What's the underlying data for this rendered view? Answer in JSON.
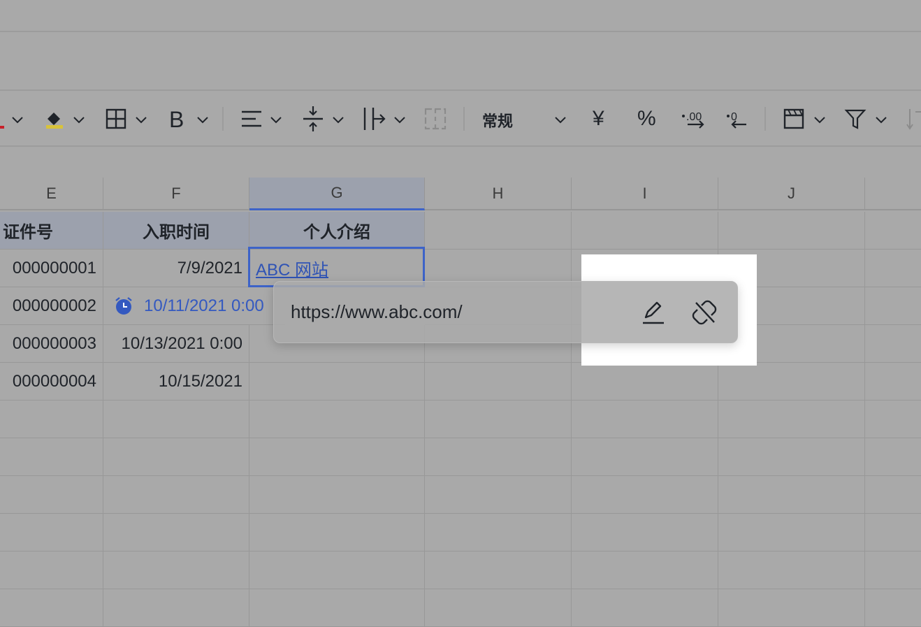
{
  "toolbar": {
    "format_label": "常规",
    "currency_symbol": "¥",
    "percent_symbol": "%",
    "font_color": "#c8202a",
    "fill_color": "#d8c33a"
  },
  "columns": [
    {
      "label": "E"
    },
    {
      "label": "F"
    },
    {
      "label": "G"
    },
    {
      "label": "H"
    },
    {
      "label": "I"
    },
    {
      "label": "J"
    }
  ],
  "table": {
    "headers": [
      "证件号",
      "入职时间",
      "个人介绍"
    ],
    "rows": [
      {
        "id": "000000001",
        "date": "7/9/2021",
        "intro": "ABC 网站"
      },
      {
        "id": "000000002",
        "date": "10/11/2021 0:00",
        "intro": ""
      },
      {
        "id": "000000003",
        "date": "10/13/2021 0:00",
        "intro": ""
      },
      {
        "id": "000000004",
        "date": "10/15/2021",
        "intro": ""
      }
    ]
  },
  "link_popup": {
    "url": "https://www.abc.com/",
    "edit_icon": "pencil-icon",
    "unlink_icon": "unlink-icon"
  },
  "colors": {
    "selection": "#3d63c8",
    "link": "#2f53b5",
    "header_fill": "#9ca1ad"
  }
}
